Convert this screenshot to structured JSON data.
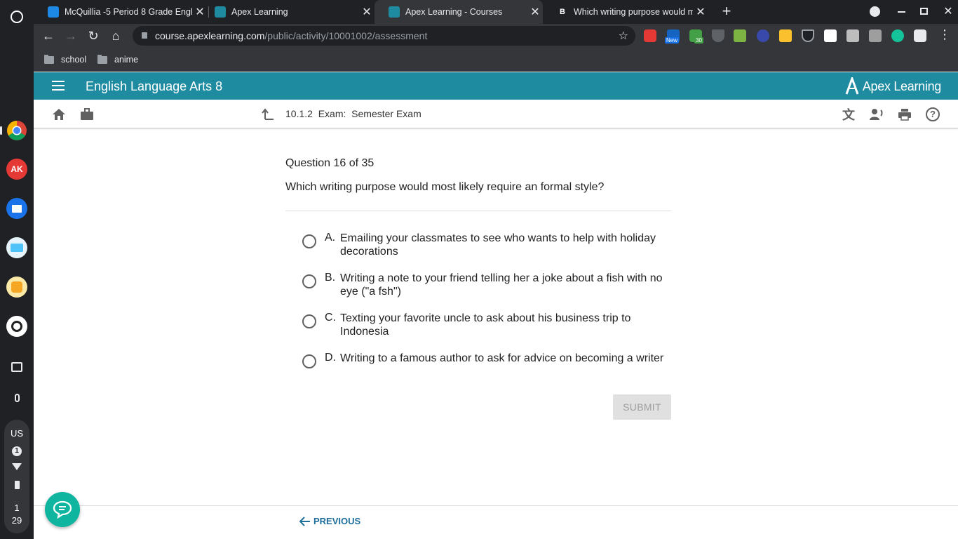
{
  "browser": {
    "tabs": [
      {
        "title": "McQuillia -5 Period 8 Grade Engl",
        "favicon_color": "#1e88e5"
      },
      {
        "title": "Apex Learning",
        "favicon_color": "#1f8ba1"
      },
      {
        "title": "Apex Learning - Courses",
        "favicon_color": "#1f8ba1"
      },
      {
        "title": "Which writing purpose would m",
        "favicon_color": "#ffffff"
      }
    ],
    "url_host": "course.apexlearning.com",
    "url_path": "/public/activity/10001002/assessment",
    "bookmarks": [
      "school",
      "anime"
    ],
    "extension_badges": {
      "new": "New",
      "count": "30"
    }
  },
  "shelf": {
    "locale": "US",
    "notification_count": "1",
    "time_hour": "1",
    "time_minute": "29",
    "app_ak": "AK"
  },
  "apex": {
    "course_title": "English Language Arts 8",
    "logo_text": "Apex Learning",
    "breadcrumb": "10.1.2  Exam:  Semester Exam"
  },
  "question": {
    "number_label": "Question 16 of 35",
    "text": "Which writing purpose would most likely require an formal style?",
    "choices": [
      {
        "letter": "A.",
        "text": "Emailing your classmates to see who wants to help with holiday decorations"
      },
      {
        "letter": "B.",
        "text": "Writing a note to your friend telling her a joke about a fish with no eye (\"a fsh\")"
      },
      {
        "letter": "C.",
        "text": "Texting your favorite uncle to ask about his business trip to Indonesia"
      },
      {
        "letter": "D.",
        "text": "Writing to a famous author to ask for advice on becoming a writer"
      }
    ],
    "submit_label": "SUBMIT"
  },
  "footer": {
    "previous_label": "PREVIOUS"
  },
  "colors": {
    "apex_header": "#1f8ba1",
    "link": "#1f6f9a",
    "chat_button": "#10b5a0"
  }
}
